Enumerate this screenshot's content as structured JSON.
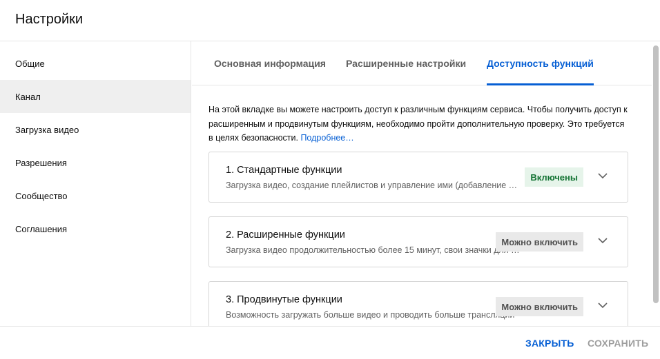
{
  "header": {
    "title": "Настройки"
  },
  "sidebar": {
    "items": [
      {
        "label": "Общие"
      },
      {
        "label": "Канал"
      },
      {
        "label": "Загрузка видео"
      },
      {
        "label": "Разрешения"
      },
      {
        "label": "Сообщество"
      },
      {
        "label": "Соглашения"
      }
    ],
    "active": "Канал"
  },
  "tabs": [
    {
      "label": "Основная информация"
    },
    {
      "label": "Расширенные настройки"
    },
    {
      "label": "Доступность функций"
    }
  ],
  "active_tab": "Доступность функций",
  "intro": {
    "text": "На этой вкладке вы можете настроить доступ к различным функциям сервиса. Чтобы получить доступ к расширенным и продвинутым функциям, необходимо пройти дополнительную проверку. Это требуется в целях безопасности.",
    "link": "Подробнее…"
  },
  "cards": [
    {
      "title": "1. Стандартные функции",
      "description": "Загрузка видео, создание плейлистов и управление ими (добавление видео и пр.)",
      "status": "Включены"
    },
    {
      "title": "2. Расширенные функции",
      "description": "Загрузка видео продолжительностью более 15 минут, свои значки для видео",
      "status": "Можно включить"
    },
    {
      "title": "3. Продвинутые функции",
      "description": "Возможность загружать больше видео и проводить больше трансляций",
      "status": "Можно включить"
    }
  ],
  "footer": {
    "close_label": "ЗАКРЫТЬ",
    "save_label": "СОХРАНИТЬ"
  },
  "colors": {
    "accent": "#065fd4",
    "enabled_bg": "#e6f4ea",
    "enabled_text": "#137333"
  }
}
